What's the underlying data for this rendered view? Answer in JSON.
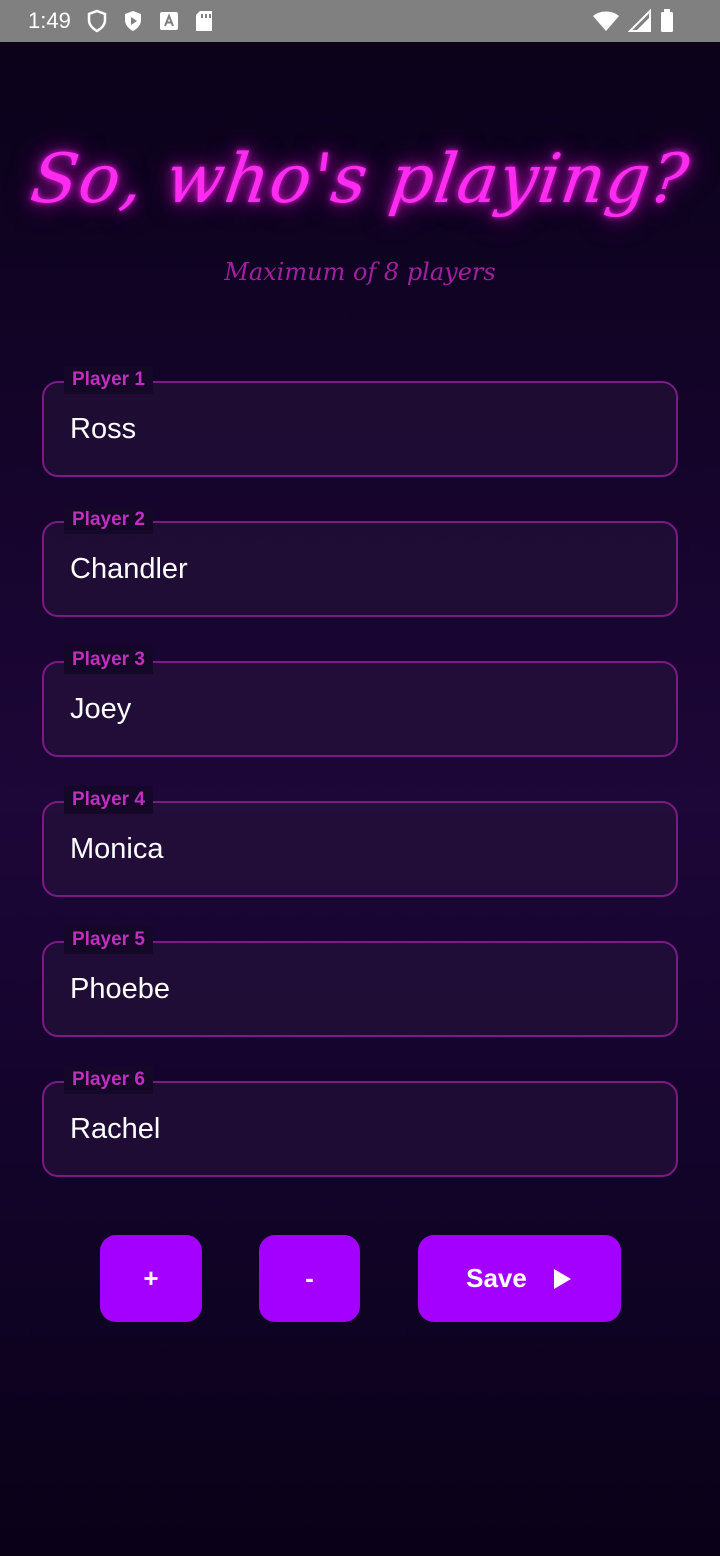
{
  "status_bar": {
    "time": "1:49",
    "left_icons": [
      "shield-outline-icon",
      "shield-filled-icon",
      "font-icon",
      "sd-card-icon"
    ],
    "right_icons": [
      "wifi-icon",
      "signal-icon",
      "battery-icon"
    ]
  },
  "header": {
    "title": "So, who's playing?",
    "subtitle": "Maximum of 8 players"
  },
  "players": [
    {
      "label": "Player 1",
      "value": "Ross"
    },
    {
      "label": "Player 2",
      "value": "Chandler"
    },
    {
      "label": "Player 3",
      "value": "Joey"
    },
    {
      "label": "Player 4",
      "value": "Monica"
    },
    {
      "label": "Player 5",
      "value": "Phoebe"
    },
    {
      "label": "Player 6",
      "value": "Rachel"
    }
  ],
  "actions": {
    "add_label": "+",
    "remove_label": "-",
    "save_label": "Save",
    "save_icon": "play-arrow-icon"
  },
  "colors": {
    "accent": "#a300ff",
    "title_neon": "#ff2bf0",
    "field_border": "#7c1a85",
    "label": "#c12fc0"
  }
}
